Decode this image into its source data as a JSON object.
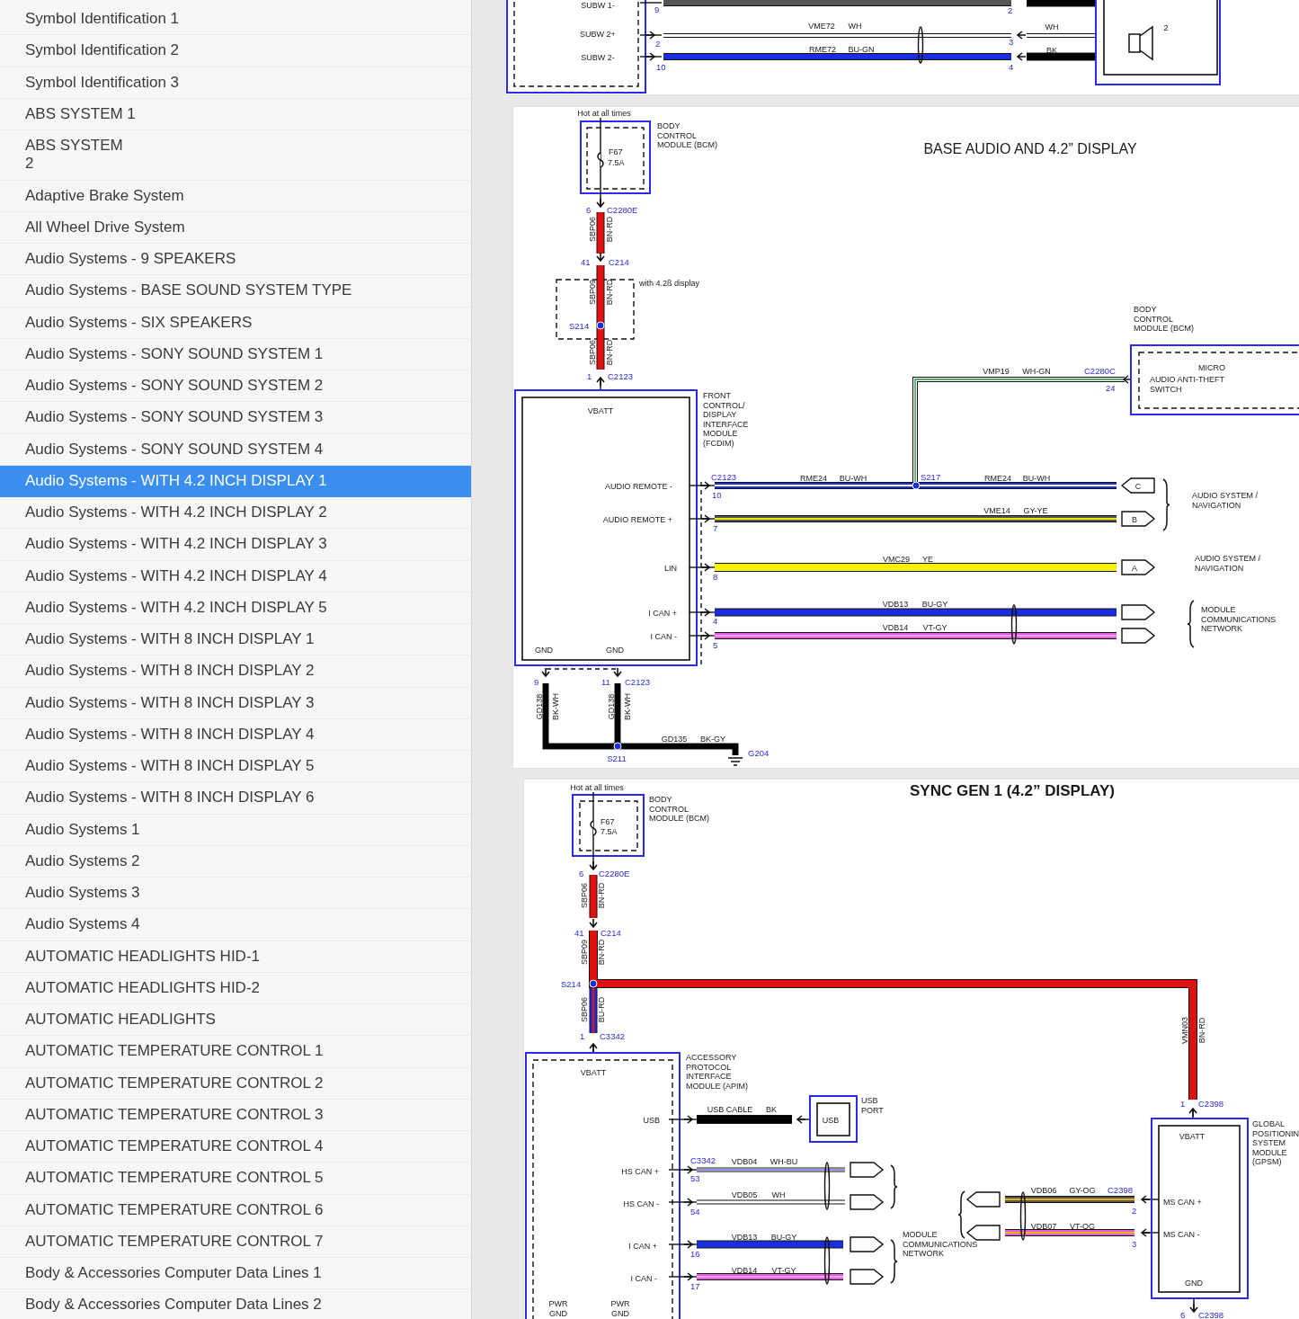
{
  "sidebar": {
    "items": [
      {
        "label": "Symbol Identification 1",
        "selected": false
      },
      {
        "label": "Symbol Identification 2",
        "selected": false
      },
      {
        "label": "Symbol Identification 3",
        "selected": false
      },
      {
        "label": "ABS SYSTEM 1",
        "selected": false
      },
      {
        "label": "ABS SYSTEM\n2",
        "selected": false
      },
      {
        "label": "Adaptive Brake System",
        "selected": false
      },
      {
        "label": "All Wheel Drive System",
        "selected": false
      },
      {
        "label": "Audio Systems - 9 SPEAKERS",
        "selected": false
      },
      {
        "label": "Audio Systems - BASE SOUND SYSTEM TYPE",
        "selected": false
      },
      {
        "label": "Audio Systems - SIX SPEAKERS",
        "selected": false
      },
      {
        "label": "Audio Systems - SONY SOUND SYSTEM 1",
        "selected": false
      },
      {
        "label": "Audio Systems - SONY SOUND SYSTEM 2",
        "selected": false
      },
      {
        "label": "Audio Systems - SONY SOUND SYSTEM 3",
        "selected": false
      },
      {
        "label": "Audio Systems - SONY SOUND SYSTEM 4",
        "selected": false
      },
      {
        "label": "Audio Systems - WITH 4.2 INCH DISPLAY 1",
        "selected": true
      },
      {
        "label": "Audio Systems - WITH 4.2 INCH DISPLAY 2",
        "selected": false
      },
      {
        "label": "Audio Systems - WITH 4.2 INCH DISPLAY 3",
        "selected": false
      },
      {
        "label": "Audio Systems - WITH 4.2 INCH DISPLAY 4",
        "selected": false
      },
      {
        "label": "Audio Systems - WITH 4.2 INCH DISPLAY 5",
        "selected": false
      },
      {
        "label": "Audio Systems - WITH 8 INCH DISPLAY 1",
        "selected": false
      },
      {
        "label": "Audio Systems - WITH 8 INCH DISPLAY 2",
        "selected": false
      },
      {
        "label": "Audio Systems - WITH 8 INCH DISPLAY 3",
        "selected": false
      },
      {
        "label": "Audio Systems - WITH 8 INCH DISPLAY 4",
        "selected": false
      },
      {
        "label": "Audio Systems - WITH 8 INCH DISPLAY 5",
        "selected": false
      },
      {
        "label": "Audio Systems - WITH 8 INCH DISPLAY 6",
        "selected": false
      },
      {
        "label": "Audio Systems 1",
        "selected": false
      },
      {
        "label": "Audio Systems 2",
        "selected": false
      },
      {
        "label": "Audio Systems 3",
        "selected": false
      },
      {
        "label": "Audio Systems 4",
        "selected": false
      },
      {
        "label": "AUTOMATIC HEADLIGHTS HID-1",
        "selected": false
      },
      {
        "label": "AUTOMATIC HEADLIGHTS HID-2",
        "selected": false
      },
      {
        "label": "AUTOMATIC HEADLIGHTS",
        "selected": false
      },
      {
        "label": "AUTOMATIC TEMPERATURE CONTROL 1",
        "selected": false
      },
      {
        "label": "AUTOMATIC TEMPERATURE CONTROL 2",
        "selected": false
      },
      {
        "label": "AUTOMATIC TEMPERATURE CONTROL 3",
        "selected": false
      },
      {
        "label": "AUTOMATIC TEMPERATURE CONTROL 4",
        "selected": false
      },
      {
        "label": "AUTOMATIC TEMPERATURE CONTROL 5",
        "selected": false
      },
      {
        "label": "AUTOMATIC TEMPERATURE CONTROL 6",
        "selected": false
      },
      {
        "label": "AUTOMATIC TEMPERATURE CONTROL 7",
        "selected": false
      },
      {
        "label": "Body & Accessories Computer Data Lines 1",
        "selected": false
      },
      {
        "label": "Body & Accessories Computer Data Lines 2",
        "selected": false
      }
    ]
  },
  "diagram_pages": [
    {
      "labels": [
        "SUBW 1-",
        "9",
        "2",
        "SUBW 2+",
        "VME72",
        "WH",
        "WH",
        "2",
        "2",
        "3",
        "SUBW 2-",
        "RME72",
        "BU-GN",
        "BK",
        "10",
        "4"
      ]
    },
    {
      "labels": [
        "Hot at all times",
        [
          "BODY",
          "CONTROL",
          "MODULE (BCM)"
        ],
        "F67",
        "7.5A",
        "6",
        "C2280E",
        "SBP06",
        "BN-RD",
        "41",
        "C214",
        "with 4.2ß display",
        "SBP09",
        "BN-RD",
        "S214",
        "SBP06",
        "BN-RD",
        "1",
        "C2123",
        "VBATT",
        [
          "FRONT",
          "CONTROL/",
          "DISPLAY",
          "INTERFACE",
          "MODULE",
          "(FCDIM)"
        ],
        "BASE AUDIO AND 4.2” DISPLAY",
        [
          "BODY",
          "CONTROL",
          "MODULE (BCM)"
        ],
        "VMP19",
        "WH-GN",
        "C2280C",
        "24",
        "MICRO",
        [
          "AUDIO ANTI-THEFT",
          "SWITCH"
        ],
        "AUDIO REMOTE -",
        "C2123",
        "10",
        "RME24",
        "BU-WH",
        "S217",
        "RME24",
        "BU-WH",
        "C",
        [
          "AUDIO SYSTEM /",
          "NAVIGATION"
        ],
        "AUDIO REMOTE +",
        "7",
        "VME14",
        "GY-YE",
        "B",
        "LIN",
        "8",
        "VMC29",
        "YE",
        "A",
        [
          "AUDIO SYSTEM /",
          "NAVIGATION"
        ],
        "I CAN +",
        "4",
        "VDB13",
        "BU-GY",
        [
          "MODULE",
          "COMMUNICATIONS",
          "NETWORK"
        ],
        "I CAN -",
        "5",
        "VDB14",
        "VT-GY",
        "GND",
        "GND",
        "9",
        "11",
        "C2123",
        "GD138",
        "BK-WH",
        "GD138",
        "BK-WH",
        "GD135",
        "BK-GY",
        "S211",
        "G204"
      ]
    },
    {
      "labels": [
        "Hot at all times",
        "SYNC GEN 1 (4.2” DISPLAY)",
        "F67",
        "7.5A",
        [
          "BODY",
          "CONTROL",
          "MODULE (BCM)"
        ],
        "6",
        "C2280E",
        "SBP06",
        "BN-RD",
        "41",
        "C214",
        "SBP09",
        "BN-RD",
        "S214",
        "SBP06",
        "BU-RD",
        "1",
        "C3342",
        "VBATT",
        [
          "ACCESSORY",
          "PROTOCOL",
          "INTERFACE",
          "MODULE (APIM)"
        ],
        "USB",
        "USB CABLE",
        "BK",
        "USB",
        [
          "USB",
          "PORT"
        ],
        "HS CAN +",
        "C3342",
        "VDB04",
        "WH-BU",
        "53",
        "HS CAN -",
        "VDB05",
        "WH",
        "54",
        "I CAN +",
        "VDB13",
        "BU-GY",
        "16",
        [
          "MODULE",
          "COMMUNICATIONS",
          "NETWORK"
        ],
        "I CAN -",
        "VDB14",
        "VT-GY",
        "17",
        [
          "PWR",
          "GND"
        ],
        [
          "PWR",
          "GND"
        ],
        "VMN03",
        "BN-RD",
        "1",
        "C2398",
        "VBATT",
        [
          "GLOBAL",
          "POSITIONIN",
          "SYSTEM",
          "MODULE",
          "(GPSM)"
        ],
        "VDB06",
        "GY-OG",
        "C2398",
        "MS CAN +",
        "2",
        "VDB07",
        "VT-OG",
        "MS CAN -",
        "3",
        "GND",
        "6",
        "C2398"
      ]
    }
  ]
}
